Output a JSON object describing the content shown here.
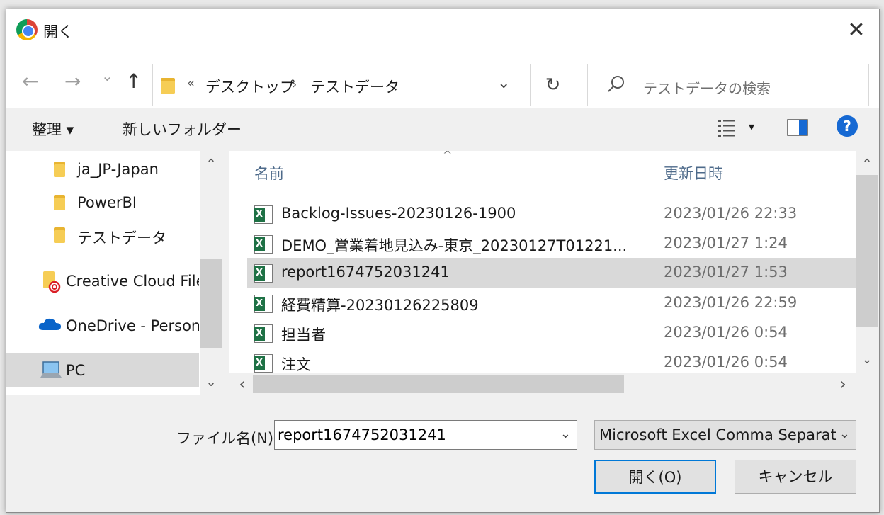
{
  "dialog": {
    "title": "開く",
    "close_glyph": "✕"
  },
  "nav": {
    "back_glyph": "←",
    "forward_glyph": "→",
    "recent_glyph": "⌄",
    "up_glyph": "↑",
    "address": {
      "overflow_glyph": "«",
      "parts": [
        "デスクトップ",
        "テストデータ"
      ],
      "separator": "›",
      "dropdown_glyph": "⌄",
      "refresh_glyph": "↻"
    },
    "search_placeholder": "テストデータの検索"
  },
  "toolbar": {
    "organize_label": "整理 ▾",
    "new_folder_label": "新しいフォルダー",
    "view_dropdown_glyph": "▾",
    "help_glyph": "?"
  },
  "sidebar": {
    "items": [
      {
        "label": "ja_JP-Japan",
        "icon": "folder-icon"
      },
      {
        "label": "PowerBI",
        "icon": "folder-icon"
      },
      {
        "label": "テストデータ",
        "icon": "folder-icon"
      },
      {
        "label": "Creative Cloud Files",
        "icon": "creative-cloud-folder-icon"
      },
      {
        "label": "OneDrive - Personal",
        "icon": "onedrive-cloud-icon"
      },
      {
        "label": "PC",
        "icon": "pc-icon",
        "selected": true
      }
    ]
  },
  "filelist": {
    "columns": [
      "名前",
      "更新日時"
    ],
    "sort_glyph": "^",
    "rows": [
      {
        "name": "Backlog-Issues-20230126-1900",
        "date": "2023/01/26 22:33"
      },
      {
        "name": "DEMO_営業着地見込み-東京_20230127T01221...",
        "date": "2023/01/27 1:24"
      },
      {
        "name": "report1674752031241",
        "date": "2023/01/27 1:53",
        "selected": true
      },
      {
        "name": "経費精算-20230126225809",
        "date": "2023/01/26 22:59"
      },
      {
        "name": "担当者",
        "date": "2023/01/26 0:54"
      },
      {
        "name": "注文",
        "date": "2023/01/26 0:54"
      }
    ]
  },
  "scroll": {
    "up_glyph": "⌃",
    "down_glyph": "⌄",
    "left_glyph": "‹",
    "right_glyph": "›"
  },
  "footer": {
    "filename_label": "ファイル名(N):",
    "filename_value": "report1674752031241",
    "filetype_value": "Microsoft Excel Comma Separated Values File",
    "dropdown_glyph": "⌄",
    "open_label": "開く(O)",
    "cancel_label": "キャンセル"
  },
  "colors": {
    "accent": "#0078d7",
    "selection": "#d9d9d9",
    "excel_green": "#1e7145",
    "help_blue": "#1669d3"
  }
}
